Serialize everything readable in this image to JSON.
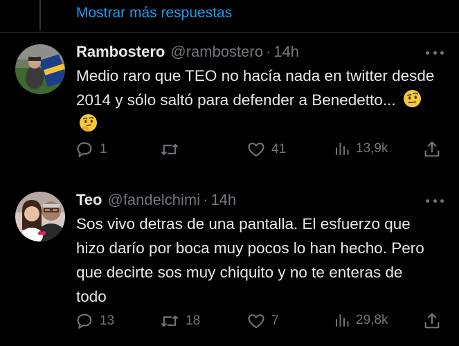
{
  "thread": {
    "show_more_label": "Mostrar más respuestas"
  },
  "tweets": [
    {
      "display_name": "Rambostero",
      "handle": "@rambostero",
      "separator": "·",
      "time": "14h",
      "text": "Medio raro que TEO no hacía nada en twitter desde 2014 y sólo saltó para defender a Benedetto...",
      "emojis": [
        "face-with-raised-eyebrow",
        "thinking-face"
      ],
      "stats": {
        "replies": "1",
        "reposts": "",
        "likes": "41",
        "views": "13,9k"
      }
    },
    {
      "display_name": "Teo",
      "handle": "@fandelchimi",
      "separator": "·",
      "time": "14h",
      "text": "Sos vivo detras de una pantalla. El esfuerzo que hizo darío por boca muy pocos lo han hecho. Pero que decirte sos muy chiquito y no te enteras de todo",
      "emojis": [],
      "stats": {
        "replies": "13",
        "reposts": "18",
        "likes": "7",
        "views": "29,8k"
      }
    }
  ],
  "icons": {
    "reply": "reply-icon",
    "repost": "repost-icon",
    "like": "heart-icon",
    "views": "views-chart-icon",
    "share": "share-icon",
    "more": "more-options-icon"
  },
  "colors": {
    "background": "#000000",
    "text": "#e7e9ea",
    "secondary": "#71767b",
    "link": "#1d9bf0",
    "divider": "#2f3336"
  }
}
